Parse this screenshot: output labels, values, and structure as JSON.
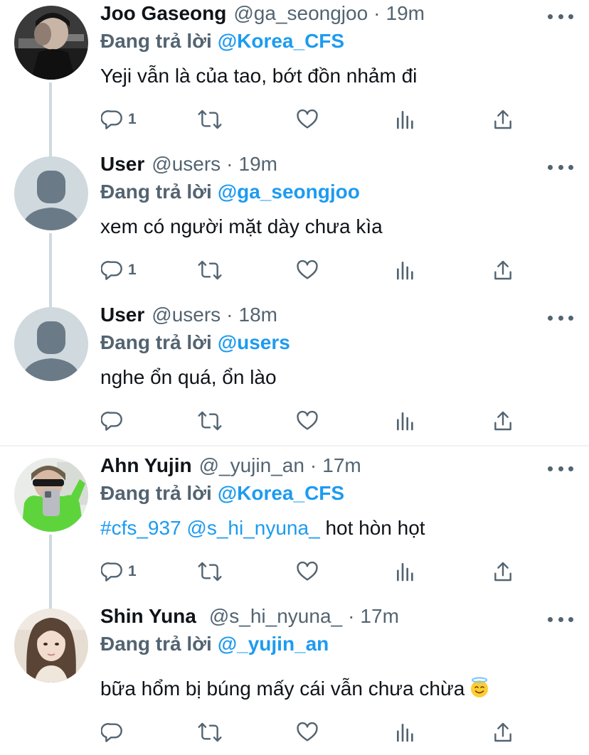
{
  "tweets": [
    {
      "name": "Joo Gaseong",
      "handle": "@ga_seongjoo",
      "dot": "·",
      "time": "19m",
      "reply_prefix": "Đang trả lời",
      "reply_to": "@Korea_CFS",
      "text": "Yeji vẫn là của tao, bớt đồn nhảm đi",
      "reply_count": "1",
      "avatar": "photo-avatar-dark"
    },
    {
      "name": "User",
      "handle": "@users",
      "dot": "·",
      "time": "19m",
      "reply_prefix": "Đang trả lời",
      "reply_to": "@ga_seongjoo",
      "text": "xem có người mặt dày chưa kìa",
      "reply_count": "1",
      "avatar": "default-avatar"
    },
    {
      "name": "User",
      "handle": "@users",
      "dot": "·",
      "time": "18m",
      "reply_prefix": "Đang trả lời",
      "reply_to": "@users",
      "text": "nghe ổn quá, ổn lào",
      "reply_count": "",
      "avatar": "default-avatar"
    },
    {
      "name": "Ahn Yujin",
      "handle": "@_yujin_an",
      "dot": "·",
      "time": "17m",
      "reply_prefix": "Đang trả lời",
      "reply_to": "@Korea_CFS",
      "text_hashtag": "#cfs_937",
      "text_mention": "@s_hi_nyuna_",
      "text_rest": "hot hòn họt",
      "reply_count": "1",
      "avatar": "photo-avatar-green"
    },
    {
      "name": "Shin Yuna",
      "handle": "@s_hi_nyuna_",
      "dot": "·",
      "time": "17m",
      "reply_prefix": "Đang trả lời",
      "reply_to": "@_yujin_an",
      "text": "bữa hổm bị búng mấy cái vẫn chưa chừa",
      "emoji": "smiling-face-with-halo",
      "reply_count": "",
      "avatar": "photo-avatar-light"
    }
  ],
  "icons": [
    "reply-icon",
    "retweet-icon",
    "like-icon",
    "views-icon",
    "share-icon",
    "more-icon"
  ],
  "colors": {
    "link": "#1d9bf0",
    "secondary": "#536471",
    "primary": "#0f1419",
    "thread": "#cfd9de"
  }
}
